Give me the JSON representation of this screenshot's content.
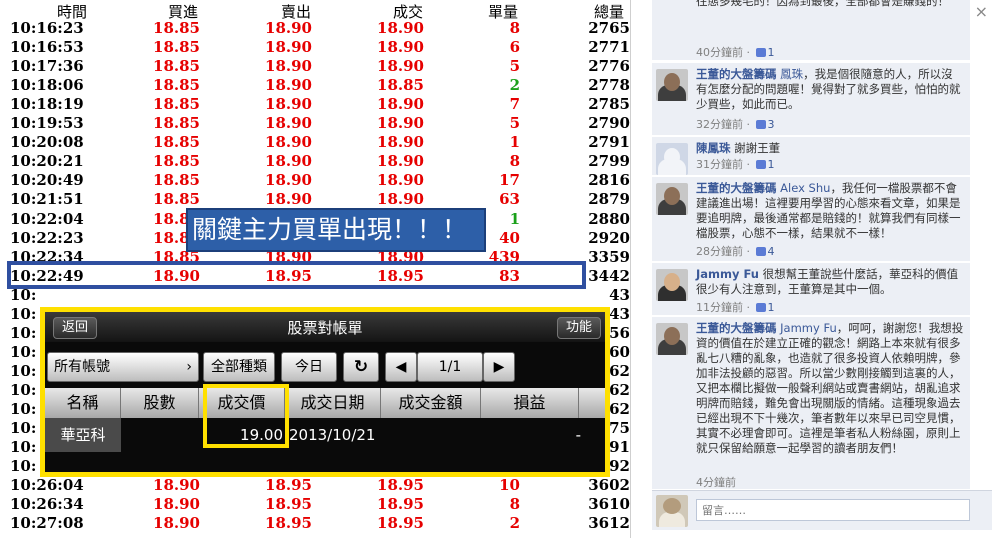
{
  "ticks": {
    "headers": {
      "time": "時間",
      "bid": "買進",
      "ask": "賣出",
      "last": "成交",
      "volume": "單量",
      "total": "總量"
    },
    "volume_colors": {
      "up": "#e60000",
      "down": "#1aa01a"
    },
    "rows": [
      {
        "time": "10:16:23",
        "bid": "18.85",
        "ask": "18.90",
        "last": "18.90",
        "volume": "8",
        "total": "2765",
        "dir": "up"
      },
      {
        "time": "10:16:53",
        "bid": "18.85",
        "ask": "18.90",
        "last": "18.90",
        "volume": "6",
        "total": "2771",
        "dir": "up"
      },
      {
        "time": "10:17:36",
        "bid": "18.85",
        "ask": "18.90",
        "last": "18.90",
        "volume": "5",
        "total": "2776",
        "dir": "up"
      },
      {
        "time": "10:18:06",
        "bid": "18.85",
        "ask": "18.90",
        "last": "18.85",
        "volume": "2",
        "total": "2778",
        "dir": "down"
      },
      {
        "time": "10:18:19",
        "bid": "18.85",
        "ask": "18.90",
        "last": "18.90",
        "volume": "7",
        "total": "2785",
        "dir": "up"
      },
      {
        "time": "10:19:53",
        "bid": "18.85",
        "ask": "18.90",
        "last": "18.90",
        "volume": "5",
        "total": "2790",
        "dir": "up"
      },
      {
        "time": "10:20:08",
        "bid": "18.85",
        "ask": "18.90",
        "last": "18.90",
        "volume": "1",
        "total": "2791",
        "dir": "up"
      },
      {
        "time": "10:20:21",
        "bid": "18.85",
        "ask": "18.90",
        "last": "18.90",
        "volume": "8",
        "total": "2799",
        "dir": "up"
      },
      {
        "time": "10:20:49",
        "bid": "18.85",
        "ask": "18.90",
        "last": "18.90",
        "volume": "17",
        "total": "2816",
        "dir": "up"
      },
      {
        "time": "10:21:51",
        "bid": "18.85",
        "ask": "18.90",
        "last": "18.90",
        "volume": "63",
        "total": "2879",
        "dir": "up"
      },
      {
        "time": "10:22:04",
        "bid": "18.85",
        "ask": "18.90",
        "last": "18.90",
        "volume": "1",
        "total": "2880",
        "dir": "down"
      },
      {
        "time": "10:22:23",
        "bid": "18.85",
        "ask": "18.90",
        "last": "18.90",
        "volume": "40",
        "total": "2920",
        "dir": "up"
      },
      {
        "time": "10:22:34",
        "bid": "18.85",
        "ask": "18.90",
        "last": "18.90",
        "volume": "439",
        "total": "3359",
        "dir": "up"
      },
      {
        "time": "10:22:49",
        "bid": "18.90",
        "ask": "18.95",
        "last": "18.95",
        "volume": "83",
        "total": "3442",
        "dir": "up"
      },
      {
        "time": "10:",
        "bid": "",
        "ask": "",
        "last": "",
        "volume": "",
        "total": "43",
        "dir": "up"
      },
      {
        "time": "10:",
        "bid": "",
        "ask": "",
        "last": "",
        "volume": "",
        "total": "43",
        "dir": "up"
      },
      {
        "time": "10:",
        "bid": "",
        "ask": "",
        "last": "",
        "volume": "",
        "total": "56",
        "dir": "up"
      },
      {
        "time": "10:",
        "bid": "",
        "ask": "",
        "last": "",
        "volume": "",
        "total": "60",
        "dir": "up"
      },
      {
        "time": "10:",
        "bid": "",
        "ask": "",
        "last": "",
        "volume": "",
        "total": "62",
        "dir": "up"
      },
      {
        "time": "10:",
        "bid": "",
        "ask": "",
        "last": "",
        "volume": "",
        "total": "62",
        "dir": "up"
      },
      {
        "time": "10:",
        "bid": "",
        "ask": "",
        "last": "",
        "volume": "",
        "total": "62",
        "dir": "up"
      },
      {
        "time": "10:",
        "bid": "",
        "ask": "",
        "last": "",
        "volume": "",
        "total": "75",
        "dir": "up"
      },
      {
        "time": "10:",
        "bid": "",
        "ask": "",
        "last": "",
        "volume": "",
        "total": "91",
        "dir": "up"
      },
      {
        "time": "10:",
        "bid": "",
        "ask": "",
        "last": "",
        "volume": "",
        "total": "92",
        "dir": "up"
      },
      {
        "time": "10:26:04",
        "bid": "18.90",
        "ask": "18.95",
        "last": "18.95",
        "volume": "10",
        "total": "3602",
        "dir": "up"
      },
      {
        "time": "10:26:34",
        "bid": "18.90",
        "ask": "18.95",
        "last": "18.95",
        "volume": "8",
        "total": "3610",
        "dir": "up"
      },
      {
        "time": "10:27:08",
        "bid": "18.90",
        "ask": "18.95",
        "last": "18.95",
        "volume": "2",
        "total": "3612",
        "dir": "up"
      }
    ]
  },
  "callout": {
    "text": "關鍵主力買單出現！！！"
  },
  "phone": {
    "back_label": "返回",
    "title": "股票對帳單",
    "function_label": "功能",
    "account_select": "所有帳號",
    "category_button": "全部種類",
    "today_button": "今日",
    "page_indicator": "1/1",
    "columns": [
      "名稱",
      "股數",
      "成交價",
      "成交日期",
      "成交金額",
      "損益"
    ],
    "row": {
      "name": "華亞科",
      "shares": "",
      "price": "19.00",
      "date": "2013/10/21",
      "amount": "",
      "pnl": "-"
    }
  },
  "feed": {
    "close_symbol": "×",
    "reply_placeholder": "留言……",
    "comments": [
      {
        "author": "",
        "mention": "",
        "text": "往態多幾毛的！因為到最後，全部都會是賺錢的！",
        "time": "40分鐘前",
        "likes": "1"
      },
      {
        "author": "王董的大盤籌碼",
        "mention": "鳳珠",
        "text": "，我是個很隨意的人，所以沒有怎麼分配的問題喔！覺得對了就多買些，怕怕的就少買些，如此而已。",
        "time": "32分鐘前",
        "likes": "3"
      },
      {
        "author": "陳鳳珠",
        "mention": "",
        "text": "謝謝王董",
        "time": "31分鐘前",
        "likes": "1"
      },
      {
        "author": "王董的大盤籌碼",
        "mention": "Alex Shu",
        "text": "，我任何一檔股票都不會建議進出場！這裡要用學習的心態來看文章，如果是要追明牌，最後通常都是賠錢的！就算我們有同樣一檔股票，心態不一樣，結果就不一樣！",
        "time": "28分鐘前",
        "likes": "4"
      },
      {
        "author": "Jammy Fu",
        "mention": "",
        "text": "很想幫王董說些什麼話，華亞科的價值很少有人注意到，王董算是其中一個。",
        "time": "11分鐘前",
        "likes": "1"
      },
      {
        "author": "王董的大盤籌碼",
        "mention": "Jammy Fu",
        "text": "，呵呵，謝謝您！我想投資的價值在於建立正確的觀念！網路上本來就有很多亂七八糟的亂象，也造就了很多投資人依賴明牌，參加非法投顧的惡習。所以當少數剛接觸到這裏的人，又把本欄比擬做一般聲利網站或賣書網站，胡亂追求明牌而賠錢，難免會出現關版的情緒。這種現象過去已經出現不下十幾次，筆者數年以來早已司空見慣，其實不必理會即可。這裡是筆者私人粉絲園，原則上就只保留給願意一起學習的讀者朋友們！",
        "time": "4分鐘前",
        "likes": ""
      }
    ]
  }
}
